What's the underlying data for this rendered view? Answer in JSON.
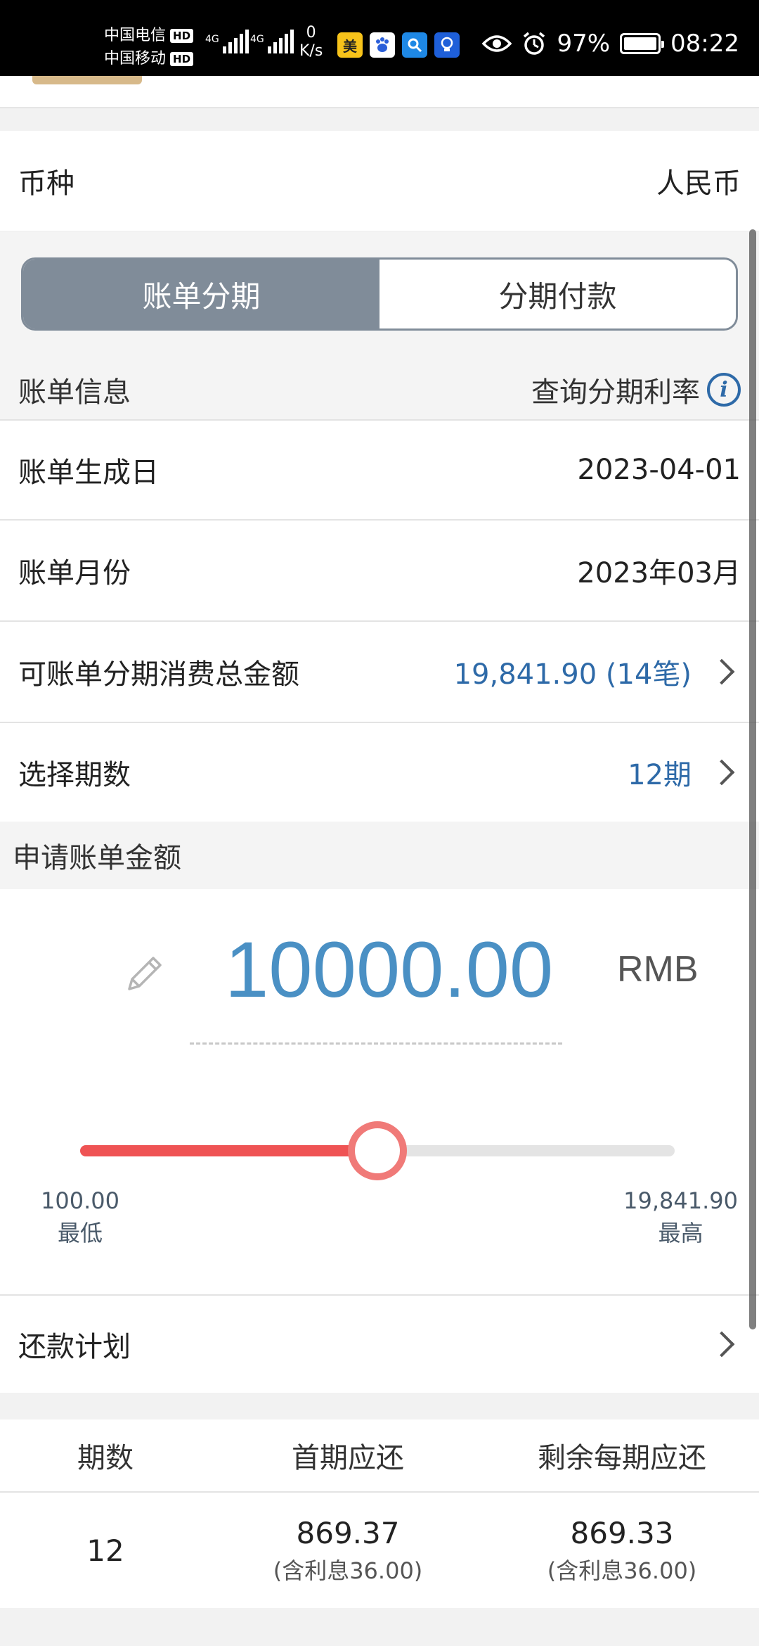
{
  "status_bar": {
    "carrier1": "中国电信",
    "carrier2": "中国移动",
    "hd_badge": "HD",
    "network_type": "4G",
    "speed_value": "0",
    "speed_unit": "K/s",
    "app_icon_meituan": "美",
    "battery_percent": "97%",
    "time": "08:22"
  },
  "currency": {
    "label": "币种",
    "value": "人民币"
  },
  "tabs": {
    "active": "账单分期",
    "inactive": "分期付款"
  },
  "bill_info": {
    "section_title": "账单信息",
    "rate_query_label": "查询分期利率",
    "info_icon_glyph": "i",
    "bill_date_label": "账单生成日",
    "bill_date_value": "2023-04-01",
    "bill_month_label": "账单月份",
    "bill_month_value": "2023年03月",
    "total_label": "可账单分期消费总金额",
    "total_value": "19,841.90 (14笔)",
    "period_label": "选择期数",
    "period_value": "12期"
  },
  "apply": {
    "section_title": "申请账单金额",
    "amount": "10000.00",
    "unit": "RMB",
    "slider_min_value": "100.00",
    "slider_min_label": "最低",
    "slider_max_value": "19,841.90",
    "slider_max_label": "最高",
    "slider_fraction": 0.5
  },
  "repayment_plan": {
    "label": "还款计划"
  },
  "table": {
    "headers": [
      "期数",
      "首期应还",
      "剩余每期应还"
    ],
    "row": {
      "periods": "12",
      "first_amount": "869.37",
      "first_interest": "(含利息36.00)",
      "rest_amount": "869.33",
      "rest_interest": "(含利息36.00)"
    }
  },
  "colors": {
    "accent_blue": "#2e6aa8",
    "amount_blue": "#4a90c4",
    "slider_red": "#ef5354",
    "segment_gray": "#808c99"
  }
}
